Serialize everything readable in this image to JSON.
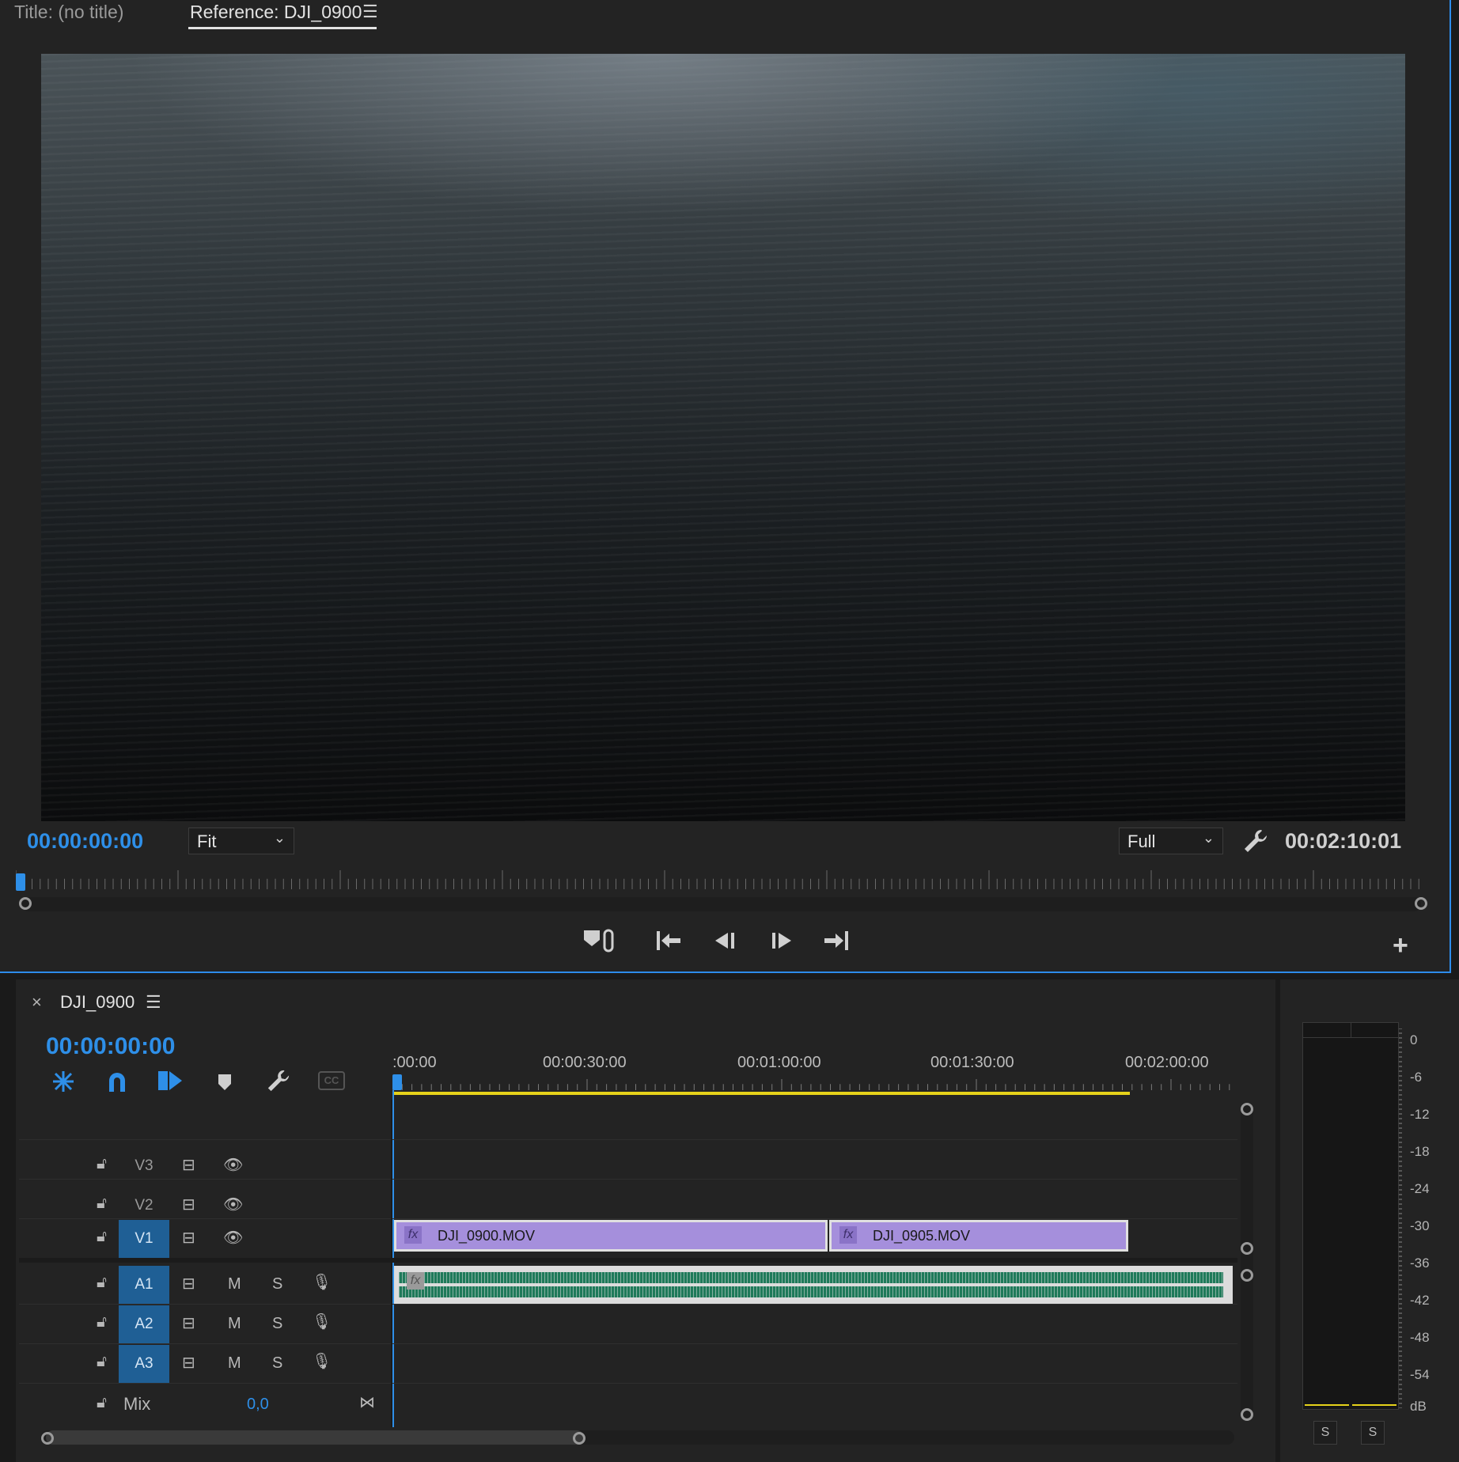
{
  "monitor": {
    "tabs": [
      {
        "label": "Title: (no title)",
        "active": false
      },
      {
        "label": "Reference: DJI_0900",
        "active": true
      }
    ],
    "menu_icon": "hamburger-icon",
    "current_timecode": "00:00:00:00",
    "zoom_select": {
      "value": "Fit"
    },
    "quality_select": {
      "value": "Full"
    },
    "settings_icon": "wrench-icon",
    "duration_timecode": "00:02:10:01",
    "transport": [
      {
        "name": "marker-link-icon",
        "glyph": "⛓"
      },
      {
        "name": "go-to-in-icon",
        "glyph": "|←"
      },
      {
        "name": "step-back-icon",
        "glyph": "◀|"
      },
      {
        "name": "step-forward-icon",
        "glyph": "|▶"
      },
      {
        "name": "go-to-out-icon",
        "glyph": "→|"
      }
    ],
    "add_button": "+"
  },
  "timeline": {
    "sequence_name": "DJI_0900",
    "close_glyph": "×",
    "current_timecode": "00:00:00:00",
    "ruler_labels": [
      ":00:00",
      "00:00:30:00",
      "00:01:00:00",
      "00:01:30:00",
      "00:02:00:00"
    ],
    "tools": [
      "snap-icon",
      "linked-selection-icon",
      "insert-overwrite-icon",
      "add-marker-icon",
      "timeline-settings-icon",
      "captions-icon"
    ],
    "captions_label": "CC",
    "video_tracks": [
      {
        "name": "V3",
        "target": false
      },
      {
        "name": "V2",
        "target": false
      },
      {
        "name": "V1",
        "target": true
      }
    ],
    "audio_tracks": [
      {
        "name": "A1",
        "mute": "M",
        "solo": "S"
      },
      {
        "name": "A2",
        "mute": "M",
        "solo": "S"
      },
      {
        "name": "A3",
        "mute": "M",
        "solo": "S"
      }
    ],
    "mix": {
      "label": "Mix",
      "value": "0,0"
    },
    "clips": [
      {
        "name": "DJI_0900.MOV",
        "fx": "fx"
      },
      {
        "name": "DJI_0905.MOV",
        "fx": "fx"
      }
    ],
    "audio_clip_fx": "fx"
  },
  "audio_meter": {
    "scale": [
      "0",
      "-6",
      "-12",
      "-18",
      "-24",
      "-30",
      "-36",
      "-42",
      "-48",
      "-54",
      "dB"
    ],
    "solo_buttons": [
      "S",
      "S"
    ]
  },
  "colors": {
    "accent_blue": "#2e8fe8",
    "clip_purple": "#a58fdc",
    "audio_green": "#1f7a5a",
    "work_area_yellow": "#e6d21a"
  }
}
